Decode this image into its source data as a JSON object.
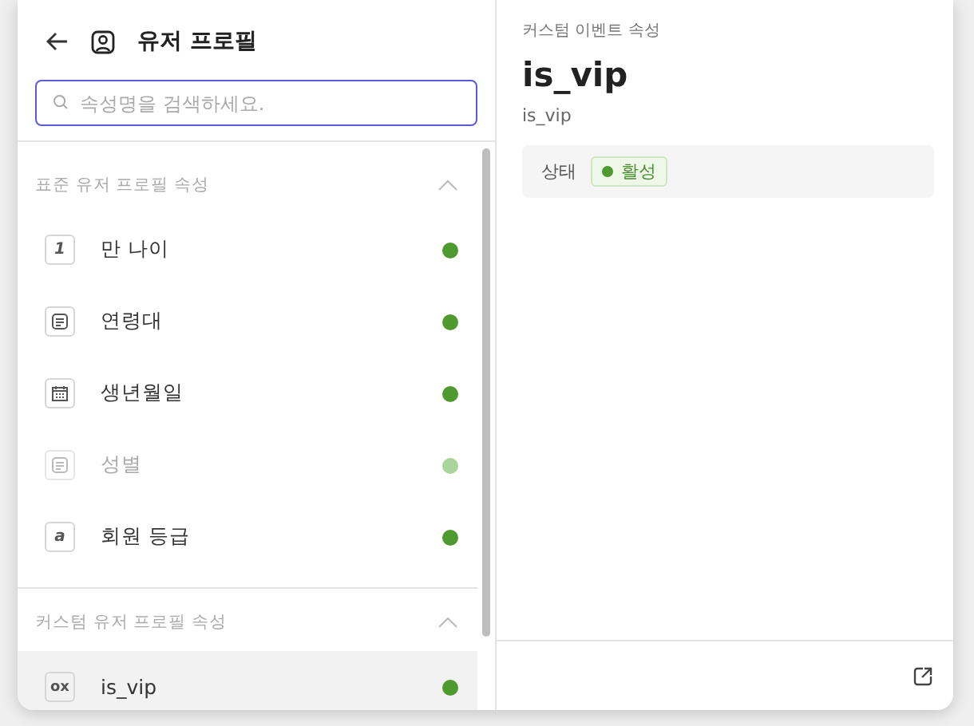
{
  "header": {
    "title": "유저 프로필"
  },
  "search": {
    "placeholder": "속성명을 검색하세요."
  },
  "sections": [
    {
      "title": "표준 유저 프로필 속성",
      "expanded": true,
      "items": [
        {
          "kind": "number",
          "glyph": "1",
          "label": "만 나이",
          "active": true,
          "selected": false
        },
        {
          "kind": "text",
          "label": "연령대",
          "active": true,
          "selected": false
        },
        {
          "kind": "date",
          "label": "생년월일",
          "active": true,
          "selected": false
        },
        {
          "kind": "text",
          "label": "성별",
          "active": false,
          "selected": false
        },
        {
          "kind": "alpha",
          "glyph": "a",
          "label": "회원 등급",
          "active": true,
          "selected": false
        }
      ]
    },
    {
      "title": "커스텀 유저 프로필 속성",
      "expanded": true,
      "items": [
        {
          "kind": "boolean",
          "glyph": "ox",
          "label": "is_vip",
          "active": true,
          "selected": true
        }
      ]
    }
  ],
  "detail": {
    "category": "커스텀 이벤트 속성",
    "title": "is_vip",
    "key": "is_vip",
    "status_label": "상태",
    "status": {
      "text": "활성",
      "active": true
    }
  }
}
